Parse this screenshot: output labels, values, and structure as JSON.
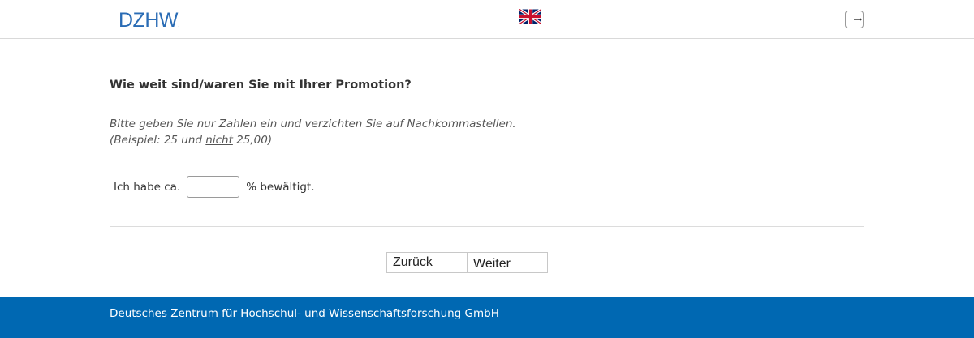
{
  "header": {
    "logo_text": "DZHW",
    "logo_dot": ".",
    "language_flag_icon": "uk-flag-icon",
    "logout_icon": "logout-icon"
  },
  "survey": {
    "question": "Wie weit sind/waren Sie mit Ihrer Promotion?",
    "hint_line1": "Bitte geben Sie nur Zahlen ein und verzichten Sie auf Nachkommastellen.",
    "hint_line2_prefix": "(Beispiel: 25 und ",
    "hint_line2_emphasis": "nicht",
    "hint_line2_suffix": " 25,00)",
    "answer_prefix": "Ich habe ca.",
    "answer_value": "",
    "answer_suffix": "% bewältigt."
  },
  "navigation": {
    "back_label": "Zurück",
    "next_label": "Weiter"
  },
  "footer": {
    "text": "Deutsches Zentrum für Hochschul- und Wissenschaftsforschung GmbH"
  },
  "colors": {
    "brand_blue": "#0068b2",
    "logo_blue": "#2a6cb5"
  }
}
